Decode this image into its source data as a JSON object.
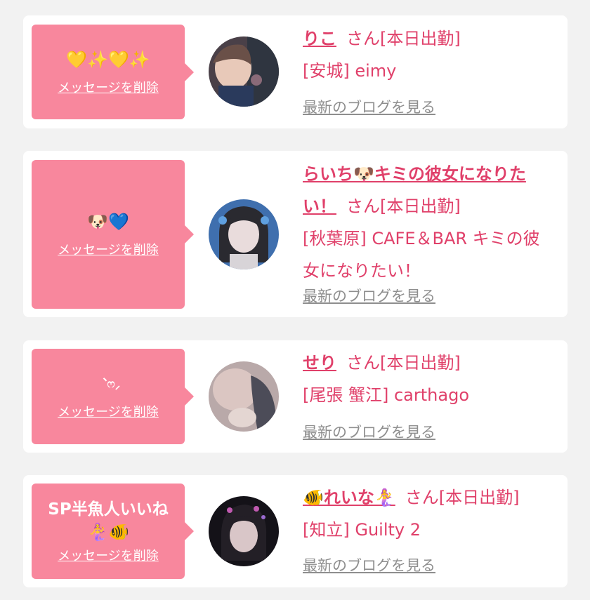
{
  "delete_label": "メッセージを削除",
  "blog_label": "最新のブログを見る",
  "suffix": "さん[本日出勤]",
  "colors": {
    "accent": "#e0406a",
    "bubble": "#f8879d",
    "background": "#f2f2f2",
    "link_gray": "#8e8e8e"
  },
  "cards": [
    {
      "message": "💛✨💛✨",
      "name": "りこ",
      "shop": "[安城] eimy",
      "avatar_icon": "avatar-photo"
    },
    {
      "message": "🐶💙",
      "name": "らいち🐶キミの彼女になりたい！",
      "shop": "[秋葉原] CAFE＆BAR キミの彼女になりたい！",
      "avatar_icon": "avatar-photo"
    },
    {
      "message": "︑ෆ⸝",
      "name": "せり",
      "shop": "[尾張 蟹江] carthago",
      "avatar_icon": "avatar-photo"
    },
    {
      "message": "SP半魚人いいね",
      "message_line2": "🧜‍♀️🐠",
      "name": "🐠れいな🧜‍♀️",
      "shop": "[知立] Guilty 2",
      "avatar_icon": "avatar-photo"
    }
  ]
}
